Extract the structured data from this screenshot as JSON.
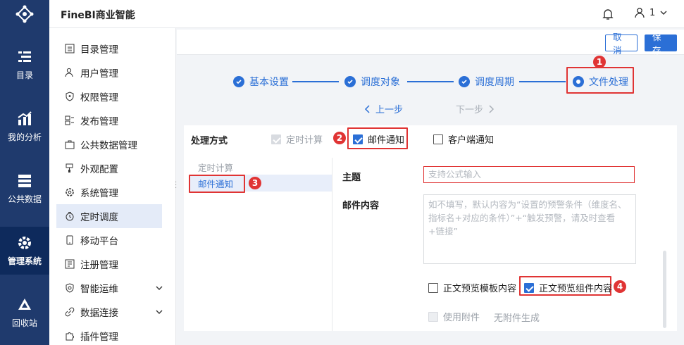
{
  "app": {
    "title": "FineBI商业智能"
  },
  "header": {
    "user_label": "1"
  },
  "rail": {
    "items": [
      {
        "label": "目录",
        "icon": "catalog-icon"
      },
      {
        "label": "我的分析",
        "icon": "analysis-icon"
      },
      {
        "label": "公共数据",
        "icon": "data-icon"
      },
      {
        "label": "管理系统",
        "icon": "gear-icon"
      },
      {
        "label": "回收站",
        "icon": "recycle-icon"
      }
    ],
    "active": "管理系统"
  },
  "menu": {
    "items": [
      {
        "label": "目录管理"
      },
      {
        "label": "用户管理"
      },
      {
        "label": "权限管理"
      },
      {
        "label": "发布管理"
      },
      {
        "label": "公共数据管理"
      },
      {
        "label": "外观配置"
      },
      {
        "label": "系统管理"
      },
      {
        "label": "定时调度"
      },
      {
        "label": "移动平台"
      },
      {
        "label": "注册管理"
      },
      {
        "label": "智能运维"
      },
      {
        "label": "数据连接"
      },
      {
        "label": "插件管理"
      }
    ],
    "active": "定时调度"
  },
  "toolbar": {
    "cancel": "取消",
    "save": "保存"
  },
  "steps": {
    "items": [
      "基本设置",
      "调度对象",
      "调度周期",
      "文件处理"
    ],
    "prev": "上一步",
    "next": "下一步"
  },
  "badges": [
    "1",
    "2",
    "3",
    "4"
  ],
  "processing": {
    "label": "处理方式",
    "options": [
      {
        "label": "定时计算",
        "checked": true,
        "disabled": true
      },
      {
        "label": "邮件通知",
        "checked": true,
        "disabled": false
      },
      {
        "label": "客户端通知",
        "checked": false,
        "disabled": false
      }
    ]
  },
  "left_list": {
    "items": [
      "定时计算",
      "邮件通知"
    ],
    "selected": "邮件通知"
  },
  "mail": {
    "subject_label": "主题",
    "subject_placeholder": "支持公式输入",
    "content_label": "邮件内容",
    "content_placeholder": "如不填写，默认内容为“设置的预警条件（维度名、指标名+对应的条件）”+“触发预警，请及时查看+链接”",
    "preview_template": "正文预览模板内容",
    "preview_component": "正文预览组件内容",
    "use_attachment": "使用附件",
    "no_attachment": "无附件生成"
  },
  "colors": {
    "primary": "#2b6fd6",
    "rail": "#1f3a6d",
    "highlight": "#e03434"
  }
}
